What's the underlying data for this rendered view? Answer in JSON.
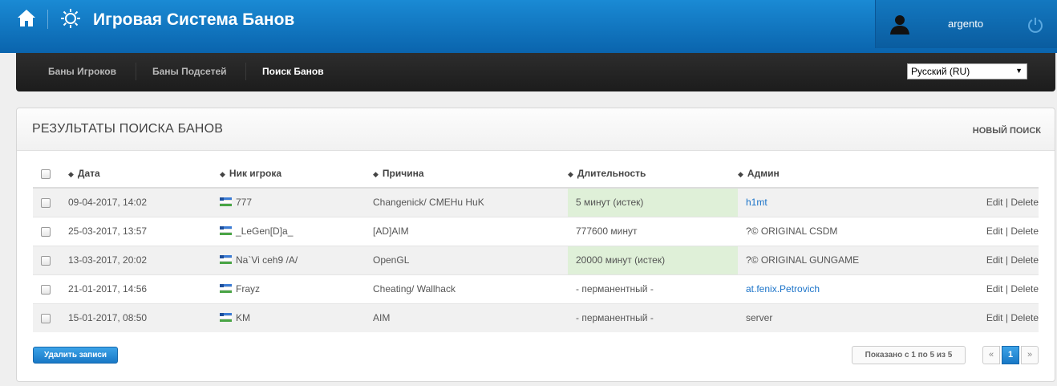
{
  "header": {
    "title": "Игровая Система Банов",
    "username": "argento"
  },
  "nav": {
    "items": [
      {
        "label": "Баны Игроков",
        "active": false
      },
      {
        "label": "Баны Подсетей",
        "active": false
      },
      {
        "label": "Поиск Банов",
        "active": true
      }
    ],
    "language": "Русский (RU)"
  },
  "panel": {
    "title": "РЕЗУЛЬТАТЫ ПОИСКА БАНОВ",
    "new_search": "НОВЫЙ ПОИСК"
  },
  "table": {
    "columns": [
      "Дата",
      "Ник игрока",
      "Причина",
      "Длительность",
      "Админ"
    ],
    "rows": [
      {
        "date": "09-04-2017, 14:02",
        "nick": "777",
        "reason": "Changenick/ CMEHu HuK",
        "duration": "5 минут (истек)",
        "admin": "h1mt",
        "admin_link": true,
        "expired": true,
        "edit": "Edit",
        "sep": "|",
        "delete": "Delete"
      },
      {
        "date": "25-03-2017, 13:57",
        "nick": "_LeGen[D]a_",
        "reason": "[AD]AIM",
        "duration": "777600 минут",
        "admin": "?© ORIGINAL CSDM",
        "admin_link": false,
        "expired": false,
        "edit": "Edit",
        "sep": "|",
        "delete": "Delete"
      },
      {
        "date": "13-03-2017, 20:02",
        "nick": "Na`Vi ceh9 /A/",
        "reason": "OpenGL",
        "duration": "20000 минут (истек)",
        "admin": "?© ORIGINAL GUNGAME",
        "admin_link": false,
        "expired": true,
        "edit": "Edit",
        "sep": "|",
        "delete": "Delete"
      },
      {
        "date": "21-01-2017, 14:56",
        "nick": "Frayz",
        "reason": "Cheating/ Wallhack",
        "duration": "- перманентный -",
        "admin": "at.fenix.Petrovich",
        "admin_link": true,
        "expired": false,
        "edit": "Edit",
        "sep": "|",
        "delete": "Delete"
      },
      {
        "date": "15-01-2017, 08:50",
        "nick": "KM",
        "reason": "AIM",
        "duration": "- перманентный -",
        "admin": "server",
        "admin_link": false,
        "expired": false,
        "edit": "Edit",
        "sep": "|",
        "delete": "Delete"
      }
    ]
  },
  "footer": {
    "delete_button": "Удалить записи",
    "shown": "Показано с 1 по 5 из 5",
    "prev": "«",
    "current_page": "1",
    "next": "»"
  },
  "icons": [
    "home-icon",
    "gear-icon",
    "user-avatar-icon",
    "power-icon",
    "flag-icon",
    "sort-icon"
  ]
}
